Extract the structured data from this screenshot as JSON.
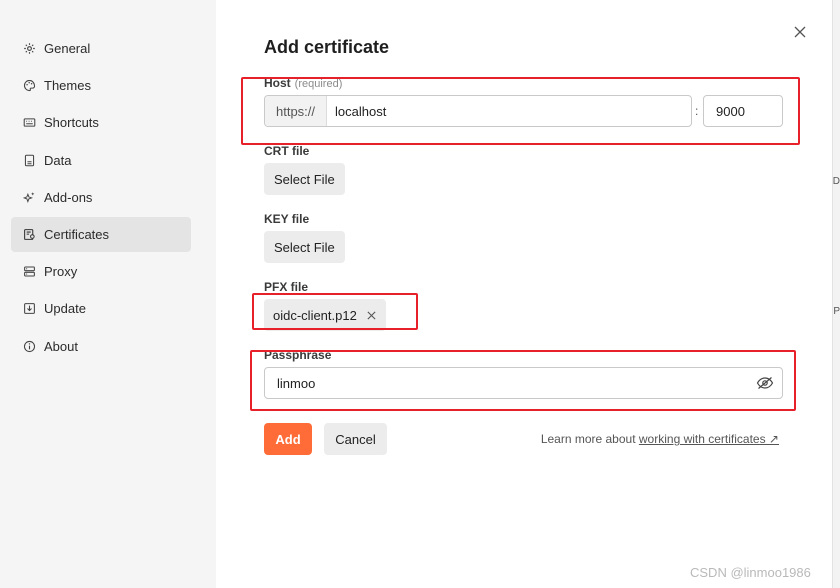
{
  "sidebar": {
    "items": [
      {
        "label": "General",
        "icon": "gear-icon"
      },
      {
        "label": "Themes",
        "icon": "palette-icon"
      },
      {
        "label": "Shortcuts",
        "icon": "keyboard-icon"
      },
      {
        "label": "Data",
        "icon": "database-icon"
      },
      {
        "label": "Add-ons",
        "icon": "sparkle-icon"
      },
      {
        "label": "Certificates",
        "icon": "certificate-icon",
        "active": true
      },
      {
        "label": "Proxy",
        "icon": "server-icon"
      },
      {
        "label": "Update",
        "icon": "download-icon"
      },
      {
        "label": "About",
        "icon": "info-icon"
      }
    ]
  },
  "modal": {
    "title": "Add certificate",
    "host": {
      "label": "Host",
      "required": "(required)",
      "prefix": "https://",
      "value": "localhost",
      "separator": ":",
      "port": "9000"
    },
    "crt": {
      "label": "CRT file",
      "button": "Select File"
    },
    "key": {
      "label": "KEY file",
      "button": "Select File"
    },
    "pfx": {
      "label": "PFX file",
      "file_name": "oidc-client.p12"
    },
    "passphrase": {
      "label": "Passphrase",
      "value": "linmoo"
    },
    "add_label": "Add",
    "cancel_label": "Cancel",
    "learn_more_text": "Learn more about",
    "learn_more_link": "working with certificates ↗"
  },
  "edge_marks": [
    "D",
    "P"
  ],
  "watermark": "CSDN @linmoo1986",
  "colors": {
    "accent": "#ff6c37",
    "annotation": "#e8202a"
  }
}
